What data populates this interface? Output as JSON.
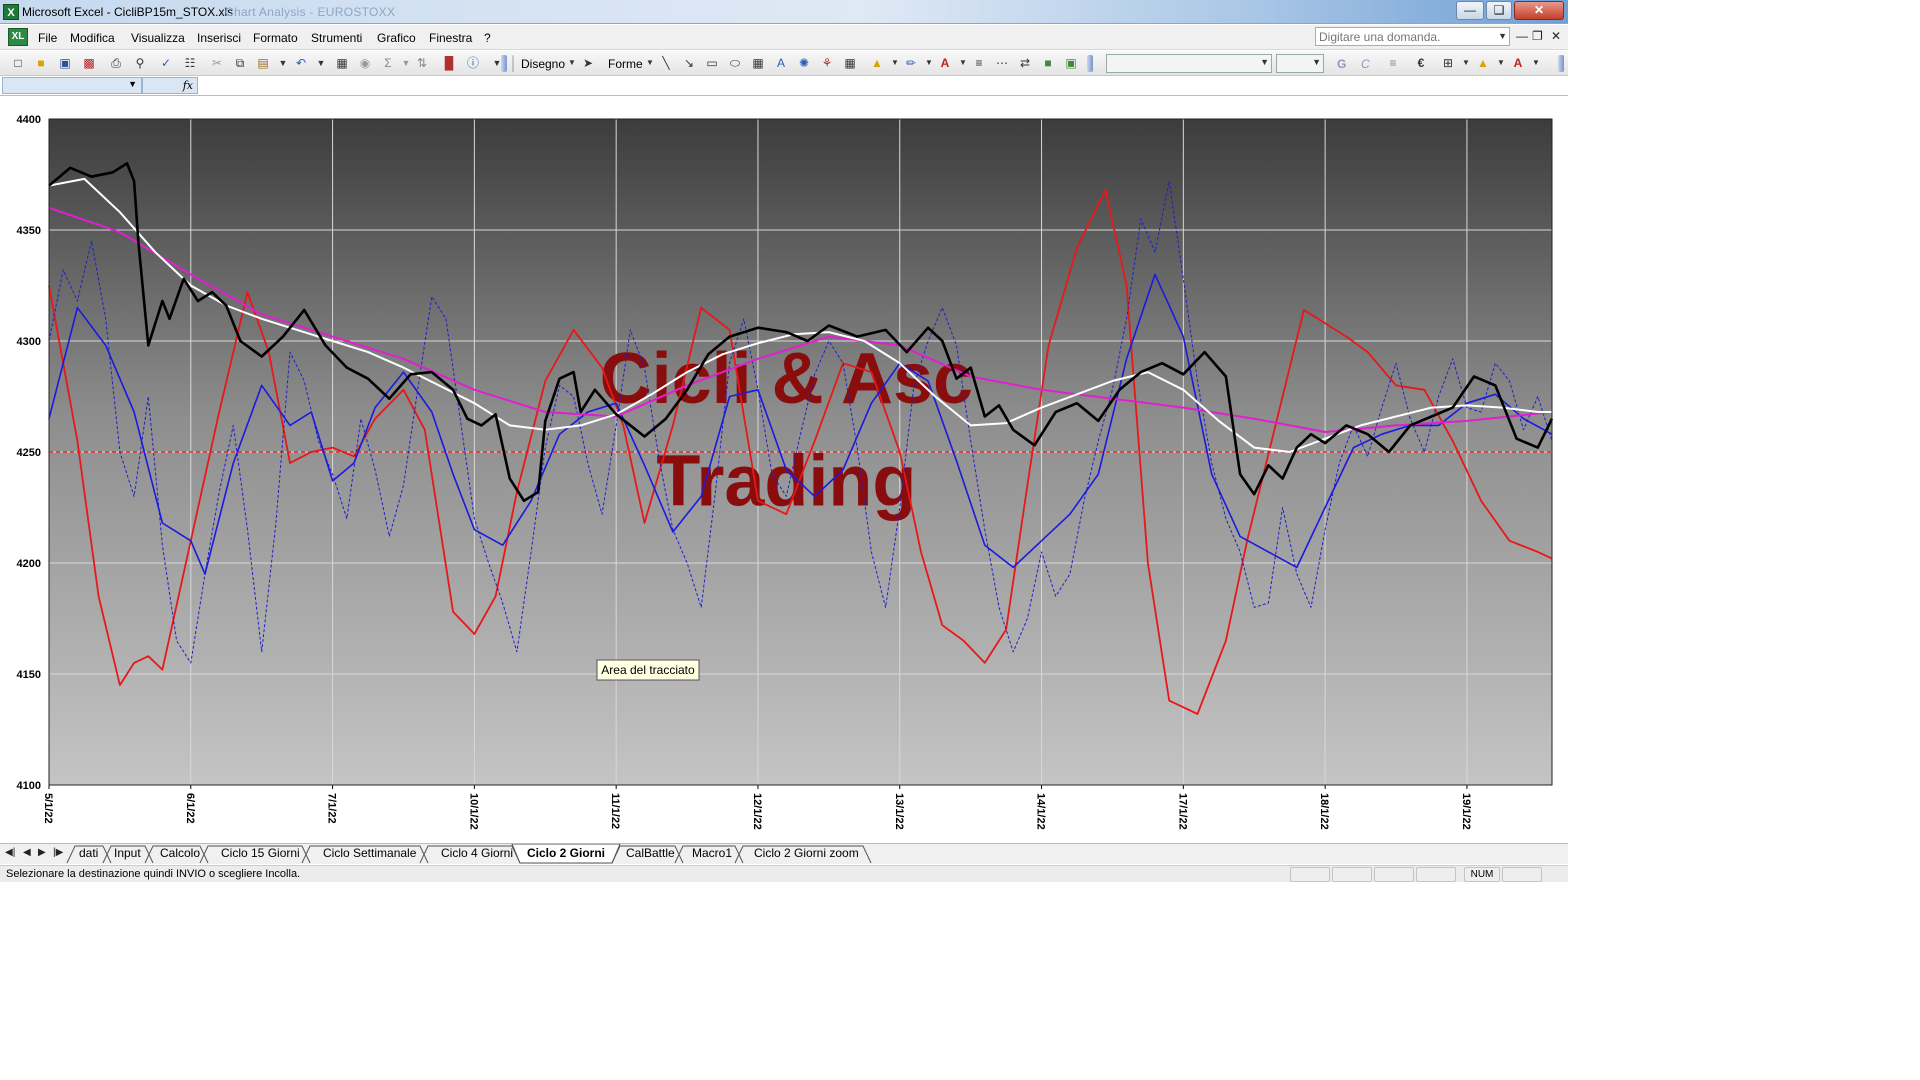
{
  "window": {
    "title": "Microsoft Excel - CicliBP15m_STOX.xls",
    "background_title": "Chart Analysis - EUROSTOXX"
  },
  "menu": {
    "items": [
      "File",
      "Modifica",
      "Visualizza",
      "Inserisci",
      "Formato",
      "Strumenti",
      "Grafico",
      "Finestra",
      "?"
    ],
    "ask_placeholder": "Digitare una domanda."
  },
  "toolbar": {
    "disegno_label": "Disegno",
    "forme_label": "Forme",
    "bold_label": "G",
    "italic_label": "C"
  },
  "sheet_tabs": {
    "items": [
      "dati",
      "Input",
      "Calcolo",
      "Ciclo 15 Giorni",
      "Ciclo Settimanale",
      "Ciclo 4 Giorni",
      "Ciclo 2 Giorni",
      "CalBattle",
      "Macro1",
      "Ciclo 2 Giorni zoom"
    ],
    "active": "Ciclo 2 Giorni"
  },
  "status": {
    "message": "Selezionare la destinazione quindi INVIO o scegliere Incolla.",
    "num_indicator": "NUM"
  },
  "chart_data": {
    "type": "line",
    "title": "",
    "watermark": [
      "Cicli & Asc",
      "Trading"
    ],
    "tooltip": "Area del tracciato",
    "xlabel": "",
    "ylabel": "",
    "ylim": [
      4100,
      4400
    ],
    "y_ticks": [
      4100,
      4150,
      4200,
      4250,
      4300,
      4350,
      4400
    ],
    "x_ticks": [
      "5/1/22",
      "6/1/22",
      "7/1/22",
      "10/1/22",
      "11/1/22",
      "12/1/22",
      "13/1/22",
      "14/1/22",
      "17/1/22",
      "18/1/22",
      "19/1/22"
    ],
    "x_range": [
      0,
      10.6
    ],
    "grid": true,
    "reference_line": {
      "value": 4250,
      "style": "dashed",
      "color": "#e83030"
    },
    "series": [
      {
        "color": "#000000",
        "width": 2.6,
        "style": "solid",
        "x": [
          0,
          0.15,
          0.3,
          0.45,
          0.55,
          0.6,
          0.63,
          0.7,
          0.8,
          0.85,
          0.95,
          1.05,
          1.15,
          1.25,
          1.35,
          1.5,
          1.65,
          1.8,
          1.95,
          2.1,
          2.25,
          2.4,
          2.55,
          2.7,
          2.85,
          2.95,
          3.05,
          3.15,
          3.25,
          3.35,
          3.45,
          3.5,
          3.6,
          3.7,
          3.75,
          3.85,
          4,
          4.2,
          4.35,
          4.5,
          4.65,
          4.8,
          5,
          5.2,
          5.35,
          5.5,
          5.7,
          5.9,
          6.05,
          6.2,
          6.3,
          6.4,
          6.5,
          6.6,
          6.7,
          6.8,
          6.95,
          7.1,
          7.25,
          7.4,
          7.55,
          7.7,
          7.85,
          8,
          8.15,
          8.3,
          8.4,
          8.5,
          8.6,
          8.7,
          8.8,
          8.9,
          9,
          9.15,
          9.3,
          9.45,
          9.6,
          9.75,
          9.9,
          10.05,
          10.2,
          10.35,
          10.5,
          10.6
        ],
        "values": [
          4370,
          4378,
          4374,
          4376,
          4380,
          4372,
          4345,
          4298,
          4318,
          4310,
          4328,
          4318,
          4322,
          4316,
          4300,
          4293,
          4302,
          4314,
          4298,
          4288,
          4283,
          4274,
          4285,
          4286,
          4278,
          4265,
          4262,
          4267,
          4238,
          4228,
          4232,
          4264,
          4283,
          4286,
          4268,
          4278,
          4267,
          4257,
          4265,
          4278,
          4294,
          4302,
          4306,
          4304,
          4300,
          4307,
          4302,
          4305,
          4295,
          4306,
          4300,
          4283,
          4288,
          4266,
          4271,
          4260,
          4253,
          4268,
          4272,
          4264,
          4278,
          4286,
          4290,
          4285,
          4295,
          4284,
          4240,
          4231,
          4244,
          4238,
          4252,
          4258,
          4254,
          4262,
          4258,
          4250,
          4262,
          4266,
          4270,
          4284,
          4280,
          4256,
          4252,
          4265
        ]
      },
      {
        "color": "#ffffff",
        "width": 2,
        "style": "solid",
        "x": [
          0,
          0.25,
          0.5,
          0.75,
          1,
          1.25,
          1.5,
          1.75,
          2,
          2.25,
          2.5,
          2.75,
          3,
          3.25,
          3.5,
          3.75,
          4,
          4.25,
          4.5,
          4.75,
          5,
          5.25,
          5.5,
          5.75,
          6,
          6.25,
          6.5,
          6.75,
          7,
          7.25,
          7.5,
          7.75,
          8,
          8.25,
          8.5,
          8.75,
          9,
          9.25,
          9.5,
          9.75,
          10,
          10.25,
          10.5,
          10.6
        ],
        "values": [
          4370,
          4373,
          4358,
          4340,
          4325,
          4316,
          4310,
          4305,
          4300,
          4295,
          4288,
          4280,
          4272,
          4262,
          4260,
          4262,
          4267,
          4276,
          4286,
          4294,
          4299,
          4303,
          4304,
          4300,
          4290,
          4275,
          4262,
          4263,
          4270,
          4276,
          4282,
          4286,
          4278,
          4264,
          4252,
          4250,
          4256,
          4262,
          4266,
          4270,
          4271,
          4270,
          4268,
          4268
        ]
      },
      {
        "color": "#e020d0",
        "width": 2,
        "style": "solid",
        "x": [
          0,
          0.5,
          1,
          1.5,
          2,
          2.5,
          3,
          3.5,
          4,
          4.5,
          5,
          5.5,
          6,
          6.5,
          7,
          7.5,
          8,
          8.5,
          9,
          9.5,
          10,
          10.6
        ],
        "values": [
          4360,
          4349,
          4330,
          4312,
          4302,
          4292,
          4278,
          4268,
          4266,
          4280,
          4292,
          4302,
          4298,
          4284,
          4278,
          4274,
          4270,
          4265,
          4259,
          4262,
          4264,
          4268
        ]
      },
      {
        "color": "#1a1ae0",
        "width": 1.6,
        "style": "solid",
        "x": [
          0,
          0.2,
          0.4,
          0.6,
          0.8,
          1,
          1.1,
          1.3,
          1.5,
          1.7,
          1.85,
          2,
          2.15,
          2.3,
          2.5,
          2.7,
          2.85,
          3,
          3.2,
          3.4,
          3.6,
          3.8,
          4,
          4.2,
          4.4,
          4.6,
          4.8,
          5,
          5.2,
          5.4,
          5.6,
          5.8,
          6,
          6.2,
          6.4,
          6.6,
          6.8,
          7,
          7.2,
          7.4,
          7.6,
          7.8,
          8,
          8.2,
          8.4,
          8.6,
          8.8,
          9,
          9.2,
          9.4,
          9.6,
          9.8,
          10,
          10.2,
          10.4,
          10.6
        ],
        "values": [
          4265,
          4315,
          4298,
          4268,
          4218,
          4210,
          4195,
          4245,
          4280,
          4262,
          4268,
          4237,
          4245,
          4270,
          4286,
          4268,
          4240,
          4215,
          4208,
          4228,
          4258,
          4268,
          4272,
          4244,
          4214,
          4230,
          4275,
          4278,
          4242,
          4230,
          4242,
          4272,
          4290,
          4282,
          4246,
          4208,
          4198,
          4210,
          4222,
          4240,
          4292,
          4330,
          4302,
          4240,
          4212,
          4205,
          4198,
          4225,
          4252,
          4258,
          4262,
          4262,
          4272,
          4276,
          4265,
          4258
        ]
      },
      {
        "color": "#e81818",
        "width": 1.8,
        "style": "solid",
        "x": [
          0,
          0.2,
          0.35,
          0.5,
          0.6,
          0.7,
          0.8,
          1,
          1.2,
          1.4,
          1.55,
          1.7,
          1.85,
          2,
          2.15,
          2.3,
          2.5,
          2.65,
          2.85,
          3,
          3.15,
          3.3,
          3.5,
          3.7,
          3.9,
          4.05,
          4.2,
          4.4,
          4.6,
          4.8,
          5,
          5.2,
          5.4,
          5.6,
          5.8,
          6,
          6.15,
          6.3,
          6.45,
          6.6,
          6.75,
          6.9,
          7.05,
          7.25,
          7.45,
          7.6,
          7.75,
          7.9,
          8.1,
          8.3,
          8.45,
          8.65,
          8.85,
          9,
          9.15,
          9.3,
          9.5,
          9.7,
          9.9,
          10.1,
          10.3,
          10.5,
          10.6
        ],
        "values": [
          4325,
          4255,
          4185,
          4145,
          4155,
          4158,
          4152,
          4210,
          4268,
          4322,
          4295,
          4245,
          4250,
          4252,
          4248,
          4265,
          4278,
          4260,
          4178,
          4168,
          4185,
          4232,
          4282,
          4305,
          4288,
          4262,
          4218,
          4262,
          4315,
          4305,
          4228,
          4222,
          4255,
          4290,
          4286,
          4250,
          4205,
          4172,
          4165,
          4155,
          4170,
          4235,
          4298,
          4342,
          4368,
          4325,
          4200,
          4138,
          4132,
          4165,
          4210,
          4262,
          4314,
          4308,
          4302,
          4295,
          4280,
          4278,
          4255,
          4228,
          4210,
          4205,
          4202
        ]
      },
      {
        "color": "#2020c8",
        "width": 1,
        "style": "dashed",
        "x": [
          0,
          0.1,
          0.2,
          0.3,
          0.4,
          0.5,
          0.6,
          0.7,
          0.8,
          0.9,
          1,
          1.1,
          1.2,
          1.3,
          1.4,
          1.5,
          1.6,
          1.7,
          1.8,
          1.9,
          2,
          2.1,
          2.2,
          2.3,
          2.4,
          2.5,
          2.6,
          2.7,
          2.8,
          2.9,
          3,
          3.1,
          3.2,
          3.3,
          3.4,
          3.5,
          3.6,
          3.7,
          3.8,
          3.9,
          4,
          4.1,
          4.2,
          4.3,
          4.4,
          4.5,
          4.6,
          4.7,
          4.8,
          4.9,
          5,
          5.1,
          5.2,
          5.3,
          5.4,
          5.5,
          5.6,
          5.7,
          5.8,
          5.9,
          6,
          6.1,
          6.2,
          6.3,
          6.4,
          6.5,
          6.6,
          6.7,
          6.8,
          6.9,
          7,
          7.1,
          7.2,
          7.3,
          7.4,
          7.5,
          7.6,
          7.7,
          7.8,
          7.9,
          8,
          8.1,
          8.2,
          8.3,
          8.4,
          8.5,
          8.6,
          8.7,
          8.8,
          8.9,
          9,
          9.1,
          9.2,
          9.3,
          9.4,
          9.5,
          9.6,
          9.7,
          9.8,
          9.9,
          10,
          10.1,
          10.2,
          10.3,
          10.4,
          10.5,
          10.6
        ],
        "values": [
          4300,
          4332,
          4318,
          4345,
          4310,
          4250,
          4230,
          4275,
          4208,
          4165,
          4155,
          4195,
          4232,
          4262,
          4215,
          4160,
          4218,
          4295,
          4282,
          4255,
          4240,
          4220,
          4265,
          4242,
          4212,
          4235,
          4278,
          4320,
          4310,
          4265,
          4220,
          4200,
          4182,
          4160,
          4205,
          4252,
          4280,
          4275,
          4245,
          4222,
          4262,
          4305,
          4288,
          4248,
          4215,
          4200,
          4180,
          4232,
          4290,
          4310,
          4278,
          4240,
          4230,
          4258,
          4285,
          4300,
          4290,
          4252,
          4205,
          4180,
          4225,
          4280,
          4300,
          4315,
          4298,
          4255,
          4215,
          4180,
          4160,
          4175,
          4205,
          4185,
          4195,
          4228,
          4255,
          4278,
          4310,
          4355,
          4340,
          4372,
          4328,
          4282,
          4245,
          4220,
          4205,
          4180,
          4182,
          4225,
          4195,
          4180,
          4215,
          4245,
          4262,
          4248,
          4270,
          4290,
          4265,
          4250,
          4275,
          4292,
          4270,
          4268,
          4290,
          4282,
          4260,
          4275,
          4255
        ]
      }
    ]
  }
}
